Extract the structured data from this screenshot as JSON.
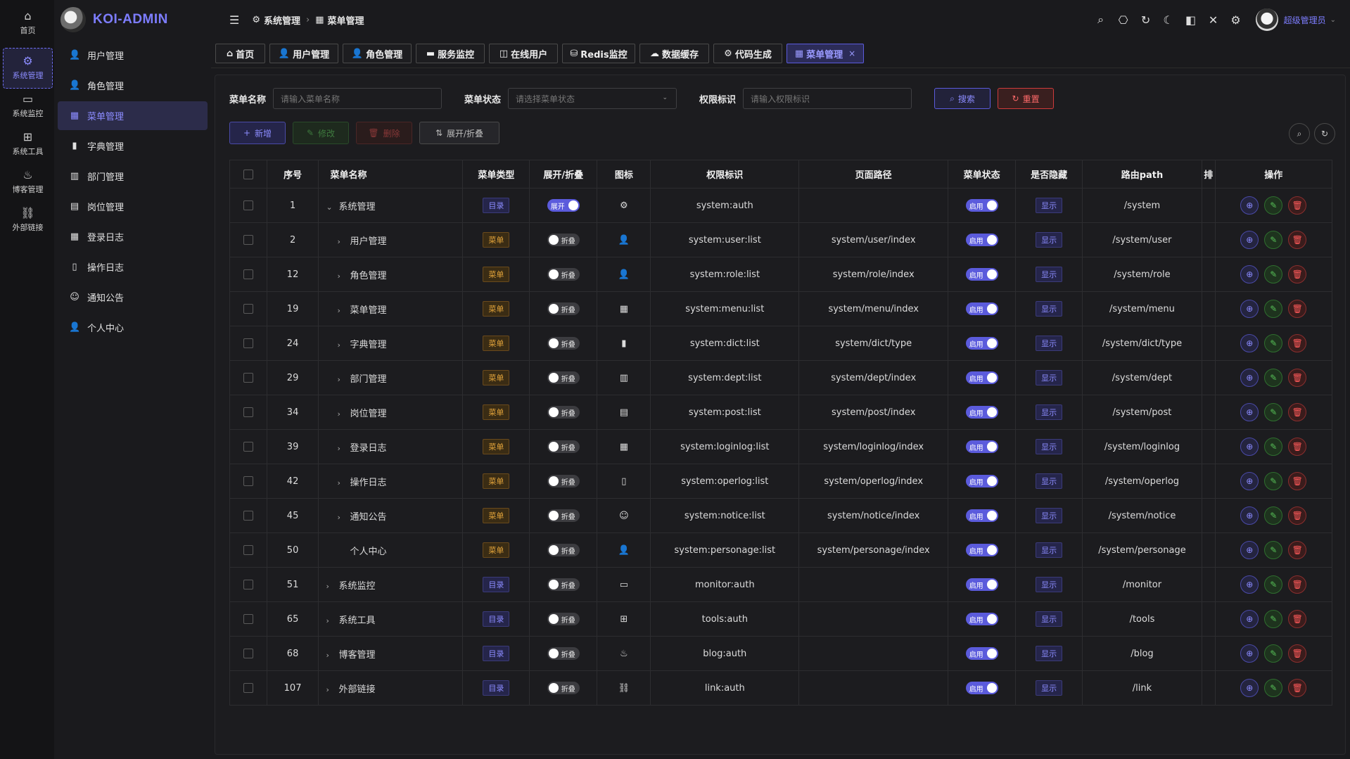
{
  "app": {
    "logo_text": "KOI-ADMIN"
  },
  "rail": [
    {
      "label": "首页",
      "icon": "⌂"
    },
    {
      "label": "系统管理",
      "icon": "⚙"
    },
    {
      "label": "系统监控",
      "icon": "▭"
    },
    {
      "label": "系统工具",
      "icon": "⊞"
    },
    {
      "label": "博客管理",
      "icon": "♨"
    },
    {
      "label": "外部链接",
      "icon": "⛓"
    }
  ],
  "sidebar": {
    "items": [
      {
        "label": "用户管理",
        "icon": "👤"
      },
      {
        "label": "角色管理",
        "icon": "👤"
      },
      {
        "label": "菜单管理",
        "icon": "▦"
      },
      {
        "label": "字典管理",
        "icon": "▮"
      },
      {
        "label": "部门管理",
        "icon": "▥"
      },
      {
        "label": "岗位管理",
        "icon": "▤"
      },
      {
        "label": "登录日志",
        "icon": "▦"
      },
      {
        "label": "操作日志",
        "icon": "▯"
      },
      {
        "label": "通知公告",
        "icon": "☺"
      },
      {
        "label": "个人中心",
        "icon": "👤"
      }
    ]
  },
  "header": {
    "breadcrumb": [
      "系统管理",
      "菜单管理"
    ],
    "user_name": "超级管理员"
  },
  "tabs": [
    {
      "label": "首页",
      "icon": "⌂"
    },
    {
      "label": "用户管理",
      "icon": "👤"
    },
    {
      "label": "角色管理",
      "icon": "👤"
    },
    {
      "label": "服务监控",
      "icon": "▬"
    },
    {
      "label": "在线用户",
      "icon": "◫"
    },
    {
      "label": "Redis监控",
      "icon": "⛁"
    },
    {
      "label": "数据缓存",
      "icon": "☁"
    },
    {
      "label": "代码生成",
      "icon": "⚙"
    },
    {
      "label": "菜单管理",
      "icon": "▦"
    }
  ],
  "search": {
    "menu_name_label": "菜单名称",
    "menu_name_placeholder": "请输入菜单名称",
    "status_label": "菜单状态",
    "status_placeholder": "请选择菜单状态",
    "perm_label": "权限标识",
    "perm_placeholder": "请输入权限标识",
    "search_btn": "搜索",
    "reset_btn": "重置"
  },
  "toolbar": {
    "add": "新增",
    "edit": "修改",
    "delete": "删除",
    "expand": "展开/折叠"
  },
  "table": {
    "headers": [
      "序号",
      "菜单名称",
      "菜单类型",
      "展开/折叠",
      "图标",
      "权限标识",
      "页面路径",
      "菜单状态",
      "是否隐藏",
      "路由path",
      "操作"
    ],
    "header_truncated": "排",
    "rows": [
      {
        "id": "1",
        "name": "系统管理",
        "arrow": "⌄",
        "indent": 0,
        "type": "目录",
        "expand": "展开",
        "icon": "⚙",
        "perm": "system:auth",
        "path": "",
        "status": "启用",
        "hidden": "显示",
        "route": "/system"
      },
      {
        "id": "2",
        "name": "用户管理",
        "arrow": "›",
        "indent": 1,
        "type": "菜单",
        "expand": "折叠",
        "icon": "👤",
        "perm": "system:user:list",
        "path": "system/user/index",
        "status": "启用",
        "hidden": "显示",
        "route": "/system/user"
      },
      {
        "id": "12",
        "name": "角色管理",
        "arrow": "›",
        "indent": 1,
        "type": "菜单",
        "expand": "折叠",
        "icon": "👤",
        "perm": "system:role:list",
        "path": "system/role/index",
        "status": "启用",
        "hidden": "显示",
        "route": "/system/role"
      },
      {
        "id": "19",
        "name": "菜单管理",
        "arrow": "›",
        "indent": 1,
        "type": "菜单",
        "expand": "折叠",
        "icon": "▦",
        "perm": "system:menu:list",
        "path": "system/menu/index",
        "status": "启用",
        "hidden": "显示",
        "route": "/system/menu"
      },
      {
        "id": "24",
        "name": "字典管理",
        "arrow": "›",
        "indent": 1,
        "type": "菜单",
        "expand": "折叠",
        "icon": "▮",
        "perm": "system:dict:list",
        "path": "system/dict/type",
        "status": "启用",
        "hidden": "显示",
        "route": "/system/dict/type"
      },
      {
        "id": "29",
        "name": "部门管理",
        "arrow": "›",
        "indent": 1,
        "type": "菜单",
        "expand": "折叠",
        "icon": "▥",
        "perm": "system:dept:list",
        "path": "system/dept/index",
        "status": "启用",
        "hidden": "显示",
        "route": "/system/dept"
      },
      {
        "id": "34",
        "name": "岗位管理",
        "arrow": "›",
        "indent": 1,
        "type": "菜单",
        "expand": "折叠",
        "icon": "▤",
        "perm": "system:post:list",
        "path": "system/post/index",
        "status": "启用",
        "hidden": "显示",
        "route": "/system/post"
      },
      {
        "id": "39",
        "name": "登录日志",
        "arrow": "›",
        "indent": 1,
        "type": "菜单",
        "expand": "折叠",
        "icon": "▦",
        "perm": "system:loginlog:list",
        "path": "system/loginlog/index",
        "status": "启用",
        "hidden": "显示",
        "route": "/system/loginlog"
      },
      {
        "id": "42",
        "name": "操作日志",
        "arrow": "›",
        "indent": 1,
        "type": "菜单",
        "expand": "折叠",
        "icon": "▯",
        "perm": "system:operlog:list",
        "path": "system/operlog/index",
        "status": "启用",
        "hidden": "显示",
        "route": "/system/operlog"
      },
      {
        "id": "45",
        "name": "通知公告",
        "arrow": "›",
        "indent": 1,
        "type": "菜单",
        "expand": "折叠",
        "icon": "☺",
        "perm": "system:notice:list",
        "path": "system/notice/index",
        "status": "启用",
        "hidden": "显示",
        "route": "/system/notice"
      },
      {
        "id": "50",
        "name": "个人中心",
        "arrow": "",
        "indent": 1,
        "type": "菜单",
        "expand": "折叠",
        "icon": "👤",
        "perm": "system:personage:list",
        "path": "system/personage/index",
        "status": "启用",
        "hidden": "显示",
        "route": "/system/personage"
      },
      {
        "id": "51",
        "name": "系统监控",
        "arrow": "›",
        "indent": 0,
        "type": "目录",
        "expand": "折叠",
        "icon": "▭",
        "perm": "monitor:auth",
        "path": "",
        "status": "启用",
        "hidden": "显示",
        "route": "/monitor"
      },
      {
        "id": "65",
        "name": "系统工具",
        "arrow": "›",
        "indent": 0,
        "type": "目录",
        "expand": "折叠",
        "icon": "⊞",
        "perm": "tools:auth",
        "path": "",
        "status": "启用",
        "hidden": "显示",
        "route": "/tools"
      },
      {
        "id": "68",
        "name": "博客管理",
        "arrow": "›",
        "indent": 0,
        "type": "目录",
        "expand": "折叠",
        "icon": "♨",
        "perm": "blog:auth",
        "path": "",
        "status": "启用",
        "hidden": "显示",
        "route": "/blog"
      },
      {
        "id": "107",
        "name": "外部链接",
        "arrow": "›",
        "indent": 0,
        "type": "目录",
        "expand": "折叠",
        "icon": "⛓",
        "perm": "link:auth",
        "path": "",
        "status": "启用",
        "hidden": "显示",
        "route": "/link"
      }
    ]
  },
  "colors": {
    "accent": "#7d7dff",
    "danger": "#ff5a5a",
    "warn": "#e0a23a",
    "success": "#58c158"
  }
}
